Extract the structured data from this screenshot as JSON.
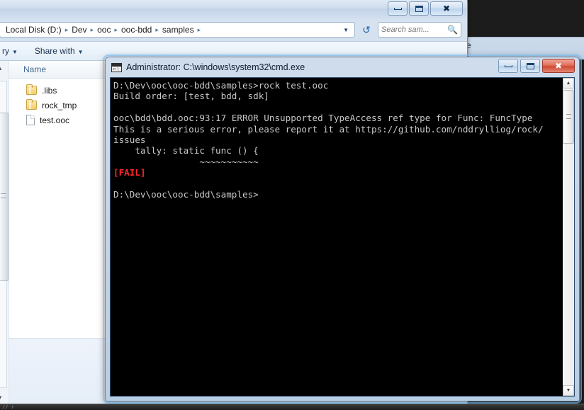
{
  "desktop": {
    "background_color": "#1c1c1c",
    "taskbar": {
      "marks": "//  r"
    }
  },
  "explorer": {
    "title": "",
    "window_buttons": {
      "minimize": "minimize-icon",
      "maximize": "maximize-icon",
      "close": "close-icon"
    },
    "address_bar": {
      "breadcrumbs": [
        "Local Disk (D:)",
        "Dev",
        "ooc",
        "ooc-bdd",
        "samples"
      ],
      "separator": "▸",
      "dropdown_icon": "chevron-down-icon",
      "refresh_icon": "refresh-icon"
    },
    "search": {
      "placeholder": "Search sam...",
      "value": "",
      "icon": "search-icon"
    },
    "command_bar": {
      "organize_label": "ry",
      "share_label": "Share with",
      "caret": "▼"
    },
    "column_headers": [
      "Name"
    ],
    "files": [
      {
        "name": ".libs",
        "type": "folder"
      },
      {
        "name": "rock_tmp",
        "type": "folder"
      },
      {
        "name": "test.ooc",
        "type": "file"
      }
    ]
  },
  "cmd_window": {
    "title": "Administrator: C:\\windows\\system32\\cmd.exe",
    "icon": "console-icon",
    "window_buttons": {
      "minimize": "minimize-icon",
      "maximize": "maximize-icon",
      "close": "close-icon"
    },
    "scrollbar": {
      "up_arrow": "▲",
      "down_arrow": "▼"
    },
    "console_lines": [
      {
        "text": "D:\\Dev\\ooc\\ooc-bdd\\samples>rock test.ooc",
        "color": "normal"
      },
      {
        "text": "Build order: [test, bdd, sdk]",
        "color": "normal"
      },
      {
        "text": "",
        "color": "normal"
      },
      {
        "text": "ooc\\bdd\\bdd.ooc:93:17 ERROR Unsupported TypeAccess ref type for Func: FuncType",
        "color": "normal"
      },
      {
        "text": "This is a serious error, please report it at https://github.com/nddrylliog/rock/",
        "color": "normal"
      },
      {
        "text": "issues",
        "color": "normal"
      },
      {
        "text": "    tally: static func () {",
        "color": "normal"
      },
      {
        "text": "                ~~~~~~~~~~~",
        "color": "normal"
      },
      {
        "text": "[FAIL]",
        "color": "red"
      },
      {
        "text": "",
        "color": "normal"
      },
      {
        "text": "D:\\Dev\\ooc\\ooc-bdd\\samples>",
        "color": "normal"
      }
    ],
    "colors": {
      "background": "#000000",
      "foreground": "#c8c8c8",
      "error": "#ff2a2a"
    }
  },
  "background_window": {
    "visible_text": "e"
  }
}
